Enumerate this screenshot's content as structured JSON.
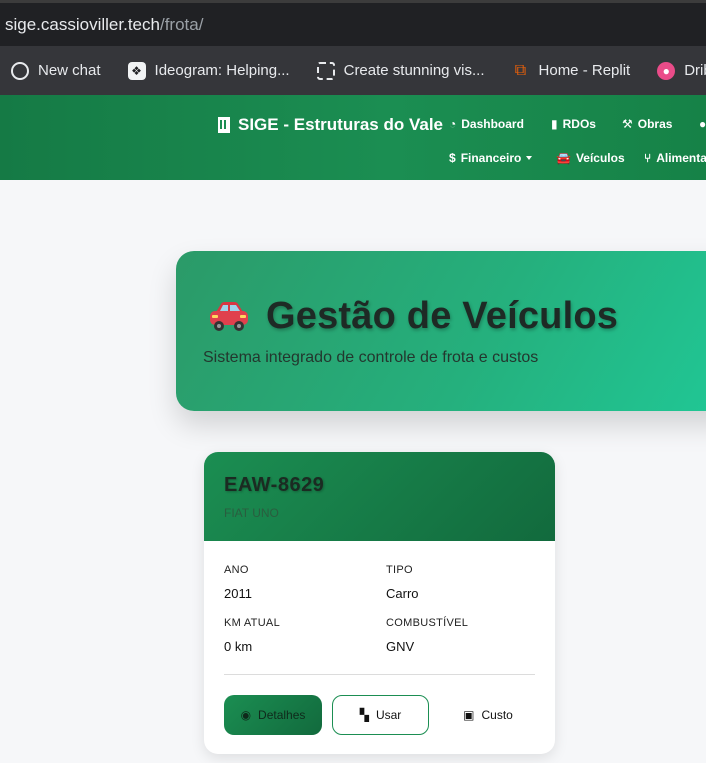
{
  "browser": {
    "url_host": "sige.cassioviller.tech",
    "url_path": "/frota/",
    "bookmarks": [
      {
        "label": "New chat",
        "icon": "openai-icon"
      },
      {
        "label": "Ideogram: Helping...",
        "icon": "ideogram-icon"
      },
      {
        "label": "Create stunning vis...",
        "icon": "frame-icon"
      },
      {
        "label": "Home - Replit",
        "icon": "replit-icon"
      },
      {
        "label": "Dribb",
        "icon": "dribbble-icon"
      }
    ]
  },
  "navbar": {
    "brand": "SIGE - Estruturas do Vale",
    "links": {
      "dashboard": "Dashboard",
      "rdos": "RDOs",
      "obras": "Obras",
      "financeiro": "Financeiro",
      "veiculos": "Veículos",
      "alimentacao": "Alimenta"
    }
  },
  "hero": {
    "title": "Gestão de Veículos",
    "subtitle": "Sistema integrado de controle de frota e custos"
  },
  "vehicle": {
    "plate": "EAW-8629",
    "model": "FIAT UNO",
    "ano_label": "ANO",
    "ano": "2011",
    "tipo_label": "TIPO",
    "tipo": "Carro",
    "km_label": "KM ATUAL",
    "km": "0 km",
    "combustivel_label": "COMBUSTÍVEL",
    "combustivel": "GNV",
    "buttons": {
      "detalhes": "Detalhes",
      "usar": "Usar",
      "custo": "Custo"
    }
  },
  "colors": {
    "primary": "#1b8e52",
    "primary_dark": "#126a3d",
    "hero_end": "#20c896"
  }
}
